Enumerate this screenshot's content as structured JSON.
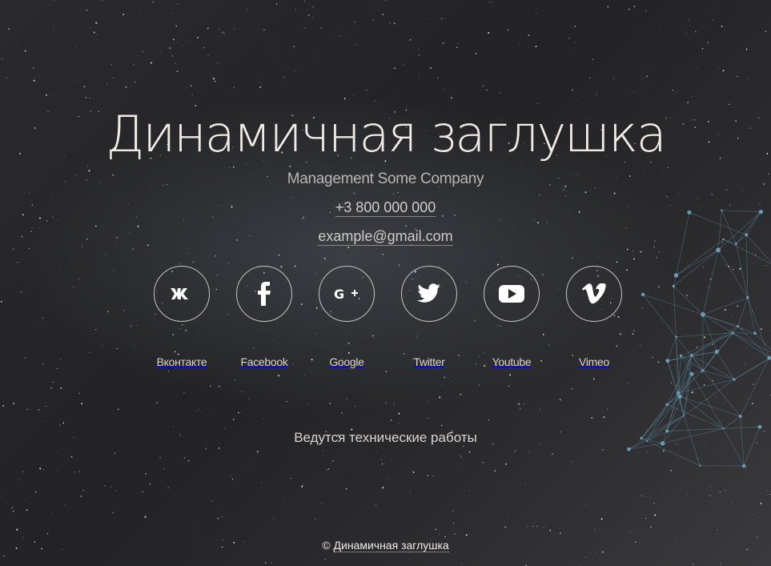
{
  "hero": {
    "title": "Динамичная заглушка",
    "subtitle": "Management Some Company",
    "phone": "+3 800 000 000",
    "email": "example@gmail.com"
  },
  "socials": [
    {
      "label": "Вконтакте",
      "icon": "vk-icon"
    },
    {
      "label": "Facebook",
      "icon": "facebook-icon"
    },
    {
      "label": "Google",
      "icon": "google-plus-icon"
    },
    {
      "label": "Twitter",
      "icon": "twitter-icon"
    },
    {
      "label": "Youtube",
      "icon": "youtube-icon"
    },
    {
      "label": "Vimeo",
      "icon": "vimeo-icon"
    }
  ],
  "status": {
    "text": "Ведутся технические работы"
  },
  "footer": {
    "copyright": "©",
    "link_text": "Динамичная заглушка"
  },
  "colors": {
    "background": "#262628",
    "text": "#e9e6e2",
    "network": "#5f8fa6"
  }
}
